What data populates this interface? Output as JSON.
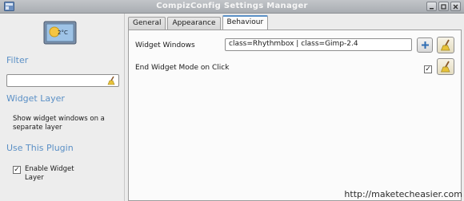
{
  "window": {
    "title": "CompizConfig Settings Manager"
  },
  "sidebar": {
    "plugin_icon_text": "2°C",
    "filter_heading": "Filter",
    "filter_value": "",
    "widget_layer_heading": "Widget Layer",
    "description": "Show widget windows on a separate layer",
    "use_plugin_heading": "Use This Plugin",
    "enable_label": "Enable Widget Layer",
    "enable_checked": "✓"
  },
  "tabs": [
    {
      "label": "General"
    },
    {
      "label": "Appearance"
    },
    {
      "label": "Behaviour"
    }
  ],
  "settings": {
    "widget_windows_label": "Widget Windows",
    "widget_windows_value": "class=Rhythmbox | class=Gimp-2.4",
    "end_widget_mode_label": "End Widget Mode on Click",
    "end_widget_mode_checked": "✓"
  },
  "watermark": "http://maketecheasier.com",
  "colors": {
    "accent": "#5b90c6",
    "background": "#ededed"
  },
  "icons": [
    "app-icon",
    "widget-plugin-icon",
    "broom-icon",
    "plus-icon",
    "minimize-icon",
    "maximize-icon",
    "close-icon"
  ]
}
